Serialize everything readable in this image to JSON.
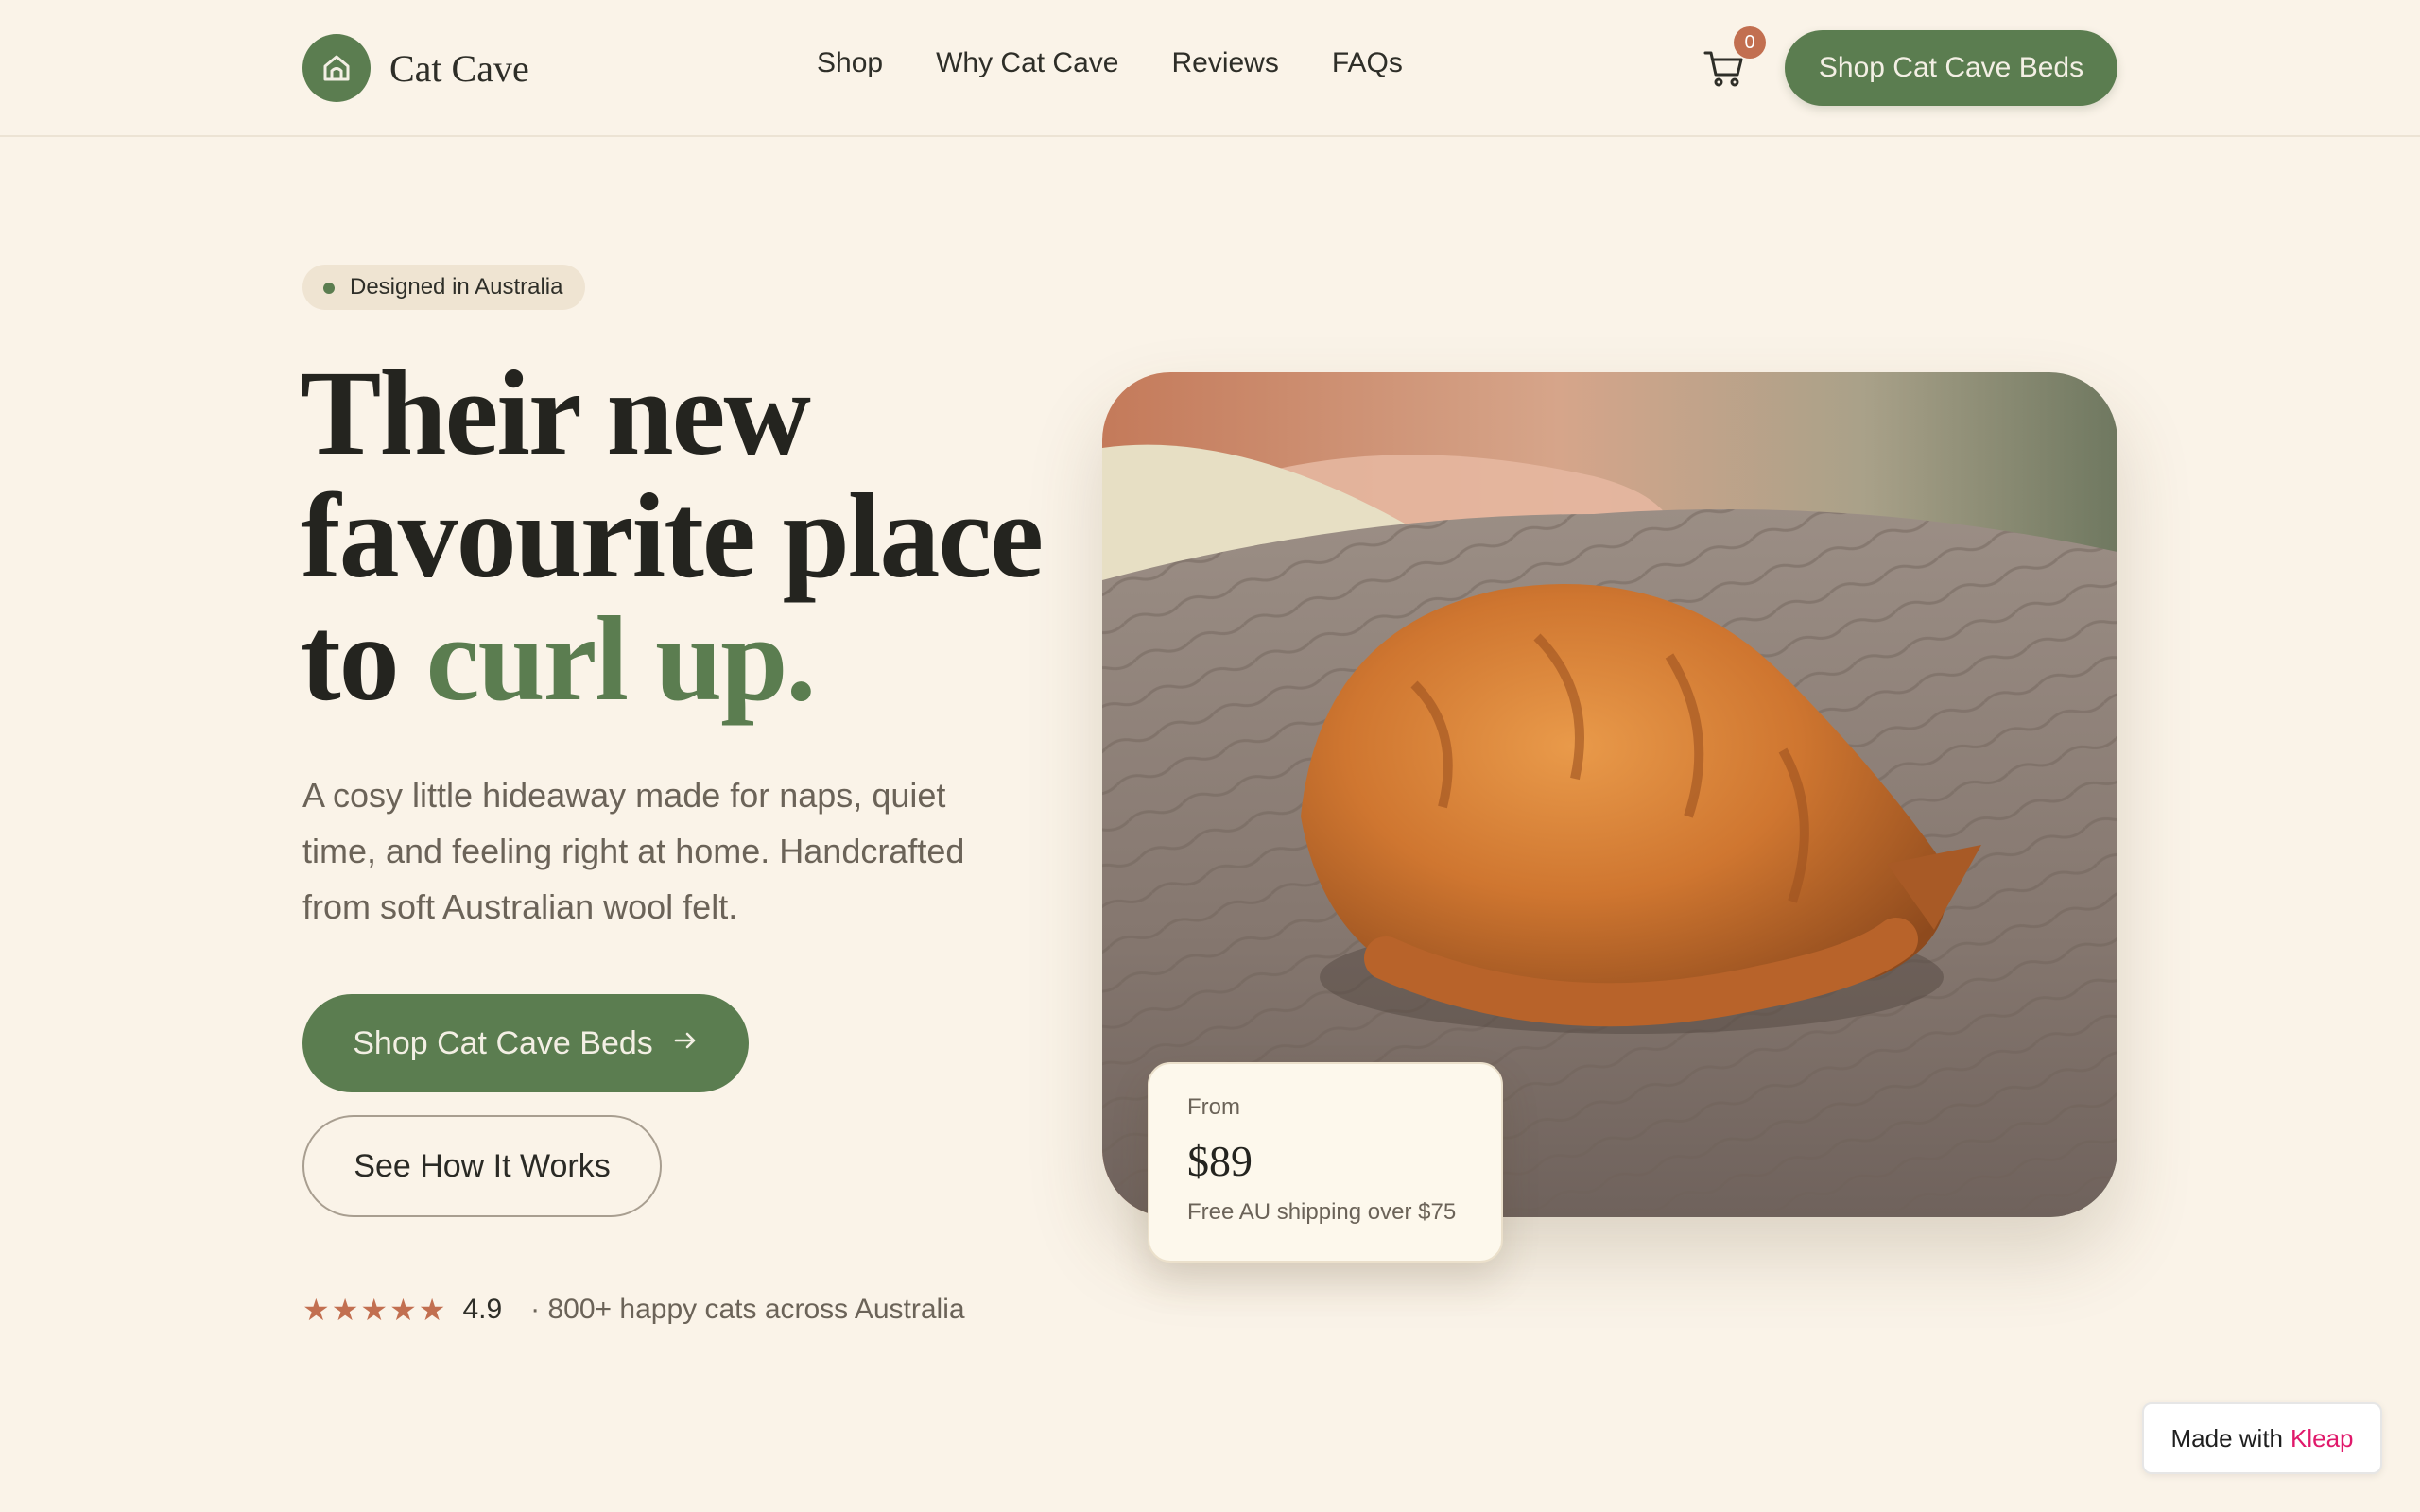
{
  "brand": {
    "name": "Cat Cave",
    "logo_icon": "home-icon",
    "accent_color": "#5b7d50"
  },
  "nav": {
    "links": [
      "Shop",
      "Why Cat Cave",
      "Reviews",
      "FAQs"
    ],
    "cart_icon": "cart-icon",
    "cart_count": "0",
    "cta_label": "Shop Cat Cave Beds"
  },
  "hero": {
    "pill_label": "Designed in Australia",
    "headline": {
      "line1": "Their new",
      "line2": "favourite place",
      "line3_prefix": "to ",
      "line3_accent": "curl up."
    },
    "subtext": "A cosy little hideaway made for naps, quiet time, and feeling right at home. Handcrafted from soft Australian wool felt.",
    "primary_cta": "Shop Cat Cave Beds",
    "primary_cta_icon": "arrow-right-icon",
    "secondary_cta": "See How It Works",
    "rating": {
      "stars": 5,
      "score": "4.9",
      "text": "· 800+ happy cats across Australia",
      "star_color": "#c26f50"
    },
    "image_subject": "ginger cat curled up asleep on a quilted bed",
    "price_card": {
      "label": "From",
      "price": "$89",
      "note": "Free AU shipping over $75"
    }
  },
  "badge": {
    "prefix": "Made with",
    "brand": "Kleap",
    "brand_color": "#e0196b"
  }
}
